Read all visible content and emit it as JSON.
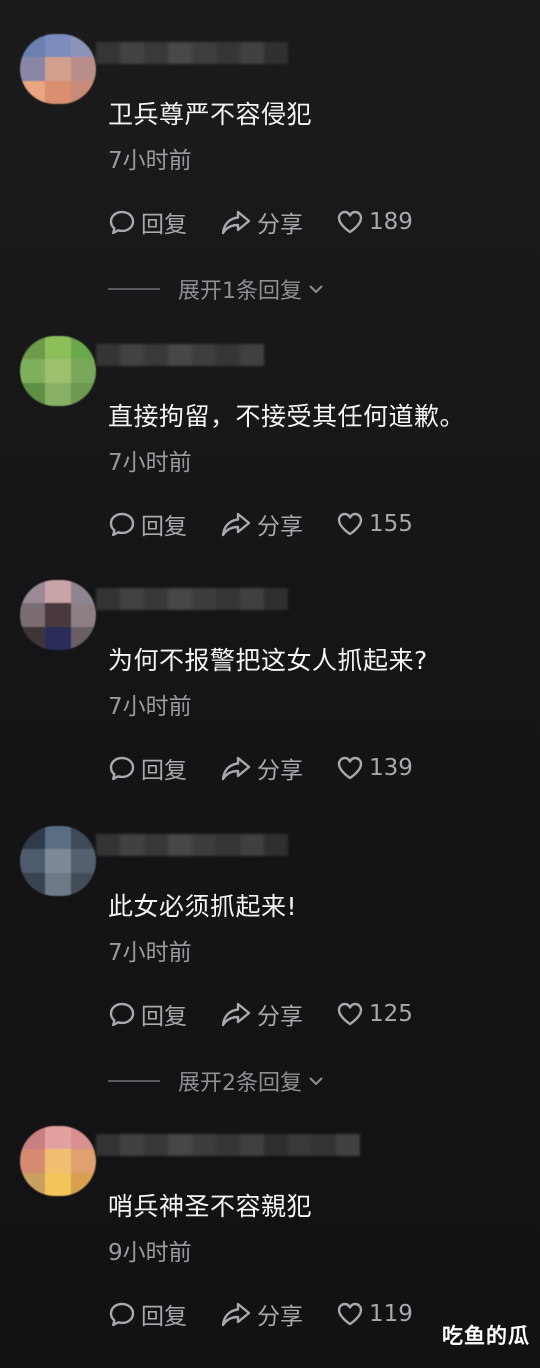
{
  "comments": [
    {
      "text": "卫兵尊严不容侵犯",
      "time": "7小时前",
      "reply_label": "回复",
      "share_label": "分享",
      "likes": "189",
      "expand": "展开1条回复",
      "avatar_colors": [
        "#6b7fb0",
        "#7c8cbf",
        "#8c95b8",
        "#8a86a8",
        "#d2a08e",
        "#b98d8a",
        "#e9a67f",
        "#d98f6f",
        "#c88b78"
      ]
    },
    {
      "text": "直接拘留，不接受其任何道歉。",
      "time": "7小时前",
      "reply_label": "回复",
      "share_label": "分享",
      "likes": "155",
      "expand": "",
      "avatar_colors": [
        "#6e9a4a",
        "#8cbf5a",
        "#6aa74d",
        "#7fb15c",
        "#9cc06e",
        "#79a85a",
        "#5f8f45",
        "#88b064",
        "#6c9a50"
      ]
    },
    {
      "text": "为何不报警把这女人抓起来?",
      "time": "7小时前",
      "reply_label": "回复",
      "share_label": "分享",
      "likes": "139",
      "expand": "",
      "avatar_colors": [
        "#9b8a95",
        "#c9a3a8",
        "#8f8590",
        "#7a6d73",
        "#4a3a3f",
        "#8e7f86",
        "#3f3537",
        "#2a2d5a",
        "#6b5f66"
      ]
    },
    {
      "text": "此女必须抓起来!",
      "time": "7小时前",
      "reply_label": "回复",
      "share_label": "分享",
      "likes": "125",
      "expand": "展开2条回复",
      "avatar_colors": [
        "#2f3a4a",
        "#5a6d82",
        "#3e4a5a",
        "#4d5b6c",
        "#7d8a96",
        "#55606e",
        "#3a4350",
        "#6e7a86",
        "#444c58"
      ]
    },
    {
      "text": "哨兵神圣不容親犯",
      "time": "9小时前",
      "reply_label": "回复",
      "share_label": "分享",
      "likes": "119",
      "expand": "",
      "avatar_colors": [
        "#c98080",
        "#e3a0a0",
        "#d99090",
        "#d88a70",
        "#f0c070",
        "#e0a070",
        "#c9a060",
        "#f2c65a",
        "#d9a050"
      ]
    }
  ],
  "name_blur_colors": [
    "#3a3a3c",
    "#4a4a4d",
    "#3f3f42",
    "#505053",
    "#454548",
    "#3c3c3f",
    "#48484b",
    "#343437",
    "#404043"
  ],
  "watermark": "吃鱼的瓜"
}
